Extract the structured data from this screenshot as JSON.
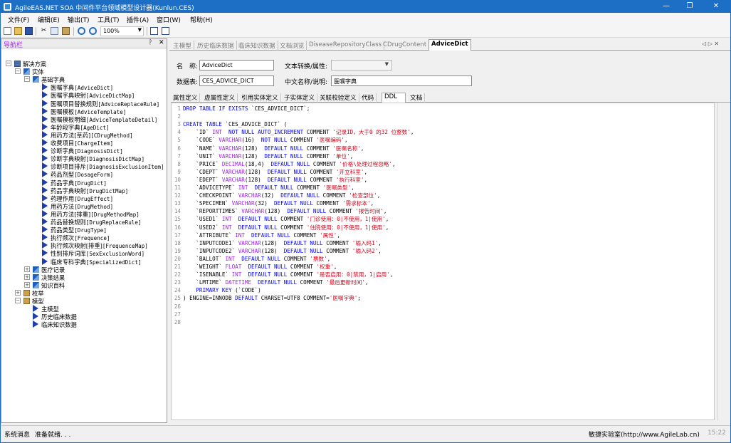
{
  "window": {
    "title": "AgileEAS.NET SOA 中间件平台领域模型设计器(Kunlun.CES)",
    "min_glyph": "—",
    "max_glyph": "❐",
    "close_glyph": "✕"
  },
  "menu": [
    "文件(F)",
    "编辑(E)",
    "输出(T)",
    "工具(T)",
    "插件(A)",
    "窗口(W)",
    "帮助(H)"
  ],
  "toolbar": {
    "zoom": "100%",
    "dropdown_glyph": "▼"
  },
  "nav": {
    "title": "导航栏",
    "pin_glyph": "ᚹ",
    "close_glyph": "✕",
    "tree": [
      {
        "label": "解决方案",
        "level": 0,
        "icon": "solution-icon",
        "toggle": "−"
      },
      {
        "label": "实体",
        "level": 1,
        "icon": "entity-group-icon",
        "toggle": "−"
      },
      {
        "label": "基础字典",
        "level": 2,
        "icon": "entity-group-icon",
        "toggle": "−"
      },
      {
        "label": "医嘱字典",
        "code": "[AdviceDict]",
        "level": 3,
        "icon": "entity-icon"
      },
      {
        "label": "医嘱字典映射",
        "code": "[AdviceDictMap]",
        "level": 3,
        "icon": "entity-icon"
      },
      {
        "label": "医嘱项目替换规则",
        "code": "[AdviceReplaceRule]",
        "level": 3,
        "icon": "entity-icon"
      },
      {
        "label": "医嘱模板",
        "code": "[AdviceTemplate]",
        "level": 3,
        "icon": "entity-icon"
      },
      {
        "label": "医嘱模板明细",
        "code": "[AdviceTemplateDetail]",
        "level": 3,
        "icon": "entity-icon"
      },
      {
        "label": "年龄段字典",
        "code": "[AgeDict]",
        "level": 3,
        "icon": "entity-icon"
      },
      {
        "label": "用药方法[草药]",
        "code": "[CDrugMethod]",
        "level": 3,
        "icon": "entity-icon"
      },
      {
        "label": "收费项目",
        "code": "[ChargeItem]",
        "level": 3,
        "icon": "entity-icon"
      },
      {
        "label": "诊断字典",
        "code": "[DiagnosisDict]",
        "level": 3,
        "icon": "entity-icon"
      },
      {
        "label": "诊断字典映射",
        "code": "[DiagnosisDictMap]",
        "level": 3,
        "icon": "entity-icon"
      },
      {
        "label": "诊断项目排斥",
        "code": "[DiagnosisExclusionItem]",
        "level": 3,
        "icon": "entity-icon"
      },
      {
        "label": "药品剂型",
        "code": "[DosageForm]",
        "level": 3,
        "icon": "entity-icon"
      },
      {
        "label": "药品字典",
        "code": "[DrugDict]",
        "level": 3,
        "icon": "entity-icon"
      },
      {
        "label": "药品字典映射",
        "code": "[DrugDictMap]",
        "level": 3,
        "icon": "entity-icon"
      },
      {
        "label": "药理作用",
        "code": "[DrugEffect]",
        "level": 3,
        "icon": "entity-icon"
      },
      {
        "label": "用药方法",
        "code": "[DrugMethod]",
        "level": 3,
        "icon": "entity-icon"
      },
      {
        "label": "用药方法[排重]",
        "code": "[DrugMethodMap]",
        "level": 3,
        "icon": "entity-icon"
      },
      {
        "label": "药品替换规则",
        "code": "[DrugReplaceRule]",
        "level": 3,
        "icon": "entity-icon"
      },
      {
        "label": "药品类型",
        "code": "[DrugType]",
        "level": 3,
        "icon": "entity-icon"
      },
      {
        "label": "执行频次",
        "code": "[Frequence]",
        "level": 3,
        "icon": "entity-icon"
      },
      {
        "label": "执行频次映射[排重]",
        "code": "[FrequenceMap]",
        "level": 3,
        "icon": "entity-icon"
      },
      {
        "label": "性别排斥词库",
        "code": "[SexExclusionWord]",
        "level": 3,
        "icon": "entity-icon"
      },
      {
        "label": "临床专科字典",
        "code": "[SpecializedDict]",
        "level": 3,
        "icon": "entity-icon"
      },
      {
        "label": "医疗记录",
        "level": 2,
        "icon": "entity-group-icon",
        "toggle": "+"
      },
      {
        "label": "决策结果",
        "level": 2,
        "icon": "entity-group-icon",
        "toggle": "+"
      },
      {
        "label": "知识百科",
        "level": 2,
        "icon": "entity-group-icon",
        "toggle": "+"
      },
      {
        "label": "枚举",
        "level": 1,
        "icon": "enum-folder-icon",
        "toggle": "+"
      },
      {
        "label": "模型",
        "level": 1,
        "icon": "model-folder-icon",
        "toggle": "−"
      },
      {
        "label": "主模型",
        "level": 2,
        "icon": "model-icon"
      },
      {
        "label": "历史临床数据",
        "level": 2,
        "icon": "model-icon"
      },
      {
        "label": "临床知识数据",
        "level": 2,
        "icon": "model-icon"
      }
    ]
  },
  "doc_tabs": [
    "主模型",
    "历史临床数据",
    "临床知识数据",
    "文档浏览",
    "DiseaseRepositoryClass",
    "CDrugContent",
    "AdviceDict"
  ],
  "doc_tab_nav": "◁ ▷ ✕",
  "form": {
    "name_label": "名　称:",
    "name_value": "AdviceDict",
    "text_transform_label": "文本转换/属性:",
    "text_transform_value": "",
    "table_label": "数据表:",
    "table_value": "CES_ADVICE_DICT",
    "cn_label": "中文名称/说明:",
    "cn_value": "医嘱字典",
    "dropdown_glyph": "▼"
  },
  "sub_tabs": [
    "属性定义",
    "虚属性定义",
    "引用实体定义",
    "子实体定义",
    "关联校验定义",
    "代码",
    "DDL",
    "文档"
  ],
  "ddl_lines": [
    [
      [
        "k",
        "DROP TABLE IF EXISTS "
      ],
      [
        "p",
        "`CES_ADVICE_DICT`;"
      ]
    ],
    [],
    [
      [
        "k",
        "CREATE TABLE "
      ],
      [
        "p",
        "`CES_ADVICE_DICT` ("
      ]
    ],
    [
      [
        "p",
        "    `ID` "
      ],
      [
        "t",
        "INT  "
      ],
      [
        "k",
        "NOT NULL AUTO_INCREMENT "
      ],
      [
        "p",
        "COMMENT "
      ],
      [
        "s",
        "'记录ID，大于0 的32 位整数'"
      ],
      [
        "p",
        ","
      ]
    ],
    [
      [
        "p",
        "    `CODE` "
      ],
      [
        "t",
        "VARCHAR"
      ],
      [
        "p",
        "(16)  "
      ],
      [
        "k",
        "NOT NULL "
      ],
      [
        "p",
        "COMMENT "
      ],
      [
        "s",
        "'医嘱编码'"
      ],
      [
        "p",
        ","
      ]
    ],
    [
      [
        "p",
        "    `NAME` "
      ],
      [
        "t",
        "VARCHAR"
      ],
      [
        "p",
        "(128)  "
      ],
      [
        "k",
        "DEFAULT NULL "
      ],
      [
        "p",
        "COMMENT "
      ],
      [
        "s",
        "'医嘱名称'"
      ],
      [
        "p",
        ","
      ]
    ],
    [
      [
        "p",
        "    `UNIT` "
      ],
      [
        "t",
        "VARCHAR"
      ],
      [
        "p",
        "(128)  "
      ],
      [
        "k",
        "DEFAULT NULL "
      ],
      [
        "p",
        "COMMENT "
      ],
      [
        "s",
        "'单位'"
      ],
      [
        "p",
        ","
      ]
    ],
    [
      [
        "p",
        "    `PRICE` "
      ],
      [
        "t",
        "DECIMAL"
      ],
      [
        "p",
        "(18,4)  "
      ],
      [
        "k",
        "DEFAULT NULL "
      ],
      [
        "p",
        "COMMENT "
      ],
      [
        "s",
        "'价格\\处理过程忽略'"
      ],
      [
        "p",
        ","
      ]
    ],
    [
      [
        "p",
        "    `CDEPT` "
      ],
      [
        "t",
        "VARCHAR"
      ],
      [
        "p",
        "(128)  "
      ],
      [
        "k",
        "DEFAULT NULL "
      ],
      [
        "p",
        "COMMENT "
      ],
      [
        "s",
        "'开立科室'"
      ],
      [
        "p",
        ","
      ]
    ],
    [
      [
        "p",
        "    `EDEPT` "
      ],
      [
        "t",
        "VARCHAR"
      ],
      [
        "p",
        "(128)  "
      ],
      [
        "k",
        "DEFAULT NULL "
      ],
      [
        "p",
        "COMMENT "
      ],
      [
        "s",
        "'执行科室'"
      ],
      [
        "p",
        ","
      ]
    ],
    [
      [
        "p",
        "    `ADVICETYPE` "
      ],
      [
        "t",
        "INT  "
      ],
      [
        "k",
        "DEFAULT NULL "
      ],
      [
        "p",
        "COMMENT "
      ],
      [
        "s",
        "'医嘱类型'"
      ],
      [
        "p",
        ","
      ]
    ],
    [
      [
        "p",
        "    `CHECKPOINT` "
      ],
      [
        "t",
        "VARCHAR"
      ],
      [
        "p",
        "(32)  "
      ],
      [
        "k",
        "DEFAULT NULL "
      ],
      [
        "p",
        "COMMENT "
      ],
      [
        "s",
        "'检查部位'"
      ],
      [
        "p",
        ","
      ]
    ],
    [
      [
        "p",
        "    `SPECIMEN` "
      ],
      [
        "t",
        "VARCHAR"
      ],
      [
        "p",
        "(32)  "
      ],
      [
        "k",
        "DEFAULT NULL "
      ],
      [
        "p",
        "COMMENT "
      ],
      [
        "s",
        "'需求标本'"
      ],
      [
        "p",
        ","
      ]
    ],
    [
      [
        "p",
        "    `REPORTTIMES` "
      ],
      [
        "t",
        "VARCHAR"
      ],
      [
        "p",
        "(128)  "
      ],
      [
        "k",
        "DEFAULT NULL "
      ],
      [
        "p",
        "COMMENT "
      ],
      [
        "s",
        "'报告时间'"
      ],
      [
        "p",
        ","
      ]
    ],
    [
      [
        "p",
        "    `USED1` "
      ],
      [
        "t",
        "INT  "
      ],
      [
        "k",
        "DEFAULT NULL "
      ],
      [
        "p",
        "COMMENT "
      ],
      [
        "s",
        "'门诊使用：0|不使用，1|使用'"
      ],
      [
        "p",
        ","
      ]
    ],
    [
      [
        "p",
        "    `USED2` "
      ],
      [
        "t",
        "INT  "
      ],
      [
        "k",
        "DEFAULT NULL "
      ],
      [
        "p",
        "COMMENT "
      ],
      [
        "s",
        "'住院使用：0|不使用，1|使用'"
      ],
      [
        "p",
        ","
      ]
    ],
    [
      [
        "p",
        "    `ATTRIBUTE` "
      ],
      [
        "t",
        "INT  "
      ],
      [
        "k",
        "DEFAULT NULL "
      ],
      [
        "p",
        "COMMENT "
      ],
      [
        "s",
        "'属性'"
      ],
      [
        "p",
        ","
      ]
    ],
    [
      [
        "p",
        "    `INPUTCODE1` "
      ],
      [
        "t",
        "VARCHAR"
      ],
      [
        "p",
        "(128)  "
      ],
      [
        "k",
        "DEFAULT NULL "
      ],
      [
        "p",
        "COMMENT "
      ],
      [
        "s",
        "'输入码1'"
      ],
      [
        "p",
        ","
      ]
    ],
    [
      [
        "p",
        "    `INPUTCODE2` "
      ],
      [
        "t",
        "VARCHAR"
      ],
      [
        "p",
        "(128)  "
      ],
      [
        "k",
        "DEFAULT NULL "
      ],
      [
        "p",
        "COMMENT "
      ],
      [
        "s",
        "'输入码2'"
      ],
      [
        "p",
        ","
      ]
    ],
    [
      [
        "p",
        "    `BALLOT` "
      ],
      [
        "t",
        "INT  "
      ],
      [
        "k",
        "DEFAULT NULL "
      ],
      [
        "p",
        "COMMENT "
      ],
      [
        "s",
        "'票数'"
      ],
      [
        "p",
        ","
      ]
    ],
    [
      [
        "p",
        "    `WEIGHT` "
      ],
      [
        "t",
        "FLOAT  "
      ],
      [
        "k",
        "DEFAULT NULL "
      ],
      [
        "p",
        "COMMENT "
      ],
      [
        "s",
        "'权重'"
      ],
      [
        "p",
        ","
      ]
    ],
    [
      [
        "p",
        "    `ISENABLE` "
      ],
      [
        "t",
        "INT  "
      ],
      [
        "k",
        "DEFAULT NULL "
      ],
      [
        "p",
        "COMMENT "
      ],
      [
        "s",
        "'是否启用：0|禁用，1|启用'"
      ],
      [
        "p",
        ","
      ]
    ],
    [
      [
        "p",
        "    `LMTIME` "
      ],
      [
        "t",
        "DATETIME  "
      ],
      [
        "k",
        "DEFAULT NULL "
      ],
      [
        "p",
        "COMMENT "
      ],
      [
        "s",
        "'最后更新时间'"
      ],
      [
        "p",
        ","
      ]
    ],
    [
      [
        "p",
        "    "
      ],
      [
        "k",
        "PRIMARY KEY "
      ],
      [
        "p",
        "(`CODE`)"
      ]
    ],
    [
      [
        "p",
        ") ENGINE=INNODB "
      ],
      [
        "k",
        "DEFAULT "
      ],
      [
        "p",
        "CHARSET=UTF8 COMMENT="
      ],
      [
        "s",
        "'医嘱字典'"
      ],
      [
        "p",
        ";"
      ]
    ],
    [],
    [],
    []
  ],
  "status": {
    "left": "系统消息",
    "message": "准备就绪. . .",
    "right": "敏捷实验室(http://www.AgileLab.cn)"
  },
  "clock": "15:22",
  "colors": {
    "titlebar": "#1c6fc4",
    "keyword": "#0000ff",
    "type": "#a020f0",
    "string": "#d4001a"
  }
}
